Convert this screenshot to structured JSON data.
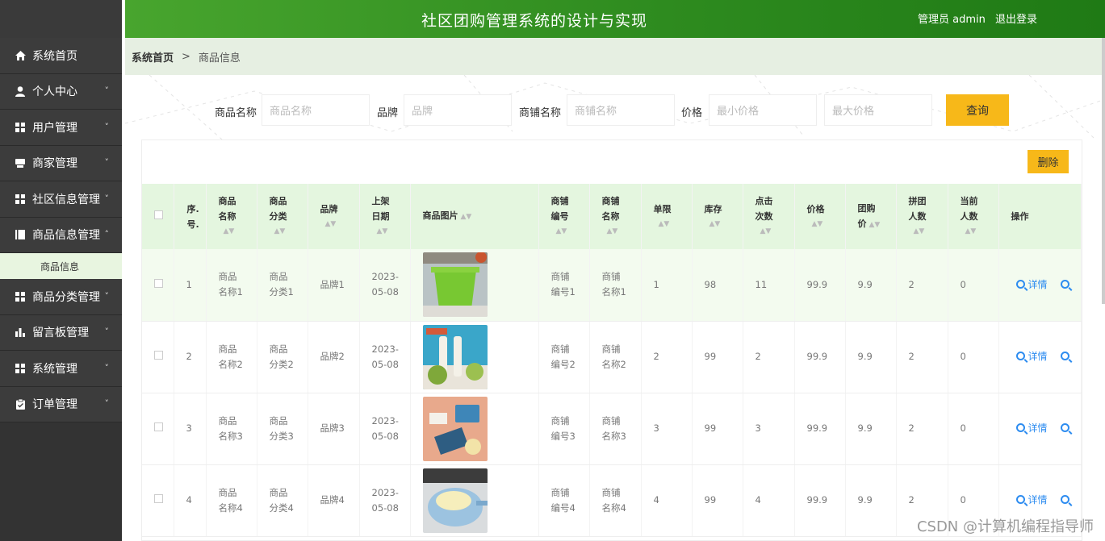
{
  "header": {
    "title": "社区团购管理系统的设计与实现",
    "user_label": "管理员 admin",
    "logout_label": "退出登录"
  },
  "sidebar": {
    "items": [
      {
        "label": "系统首页",
        "icon": "home-icon"
      },
      {
        "label": "个人中心",
        "icon": "user-icon"
      },
      {
        "label": "用户管理",
        "icon": "grid-icon"
      },
      {
        "label": "商家管理",
        "icon": "store-icon"
      },
      {
        "label": "社区信息管理",
        "icon": "grid-icon"
      },
      {
        "label": "商品信息管理",
        "icon": "book-icon"
      },
      {
        "label": "商品分类管理",
        "icon": "grid-icon"
      },
      {
        "label": "留言板管理",
        "icon": "bar-chart-icon"
      },
      {
        "label": "系统管理",
        "icon": "grid-icon"
      },
      {
        "label": "订单管理",
        "icon": "clipboard-icon"
      }
    ],
    "submenu_label": "商品信息"
  },
  "breadcrumb": {
    "home": "系统首页",
    "sep": ">",
    "current": "商品信息"
  },
  "search": {
    "name_label": "商品名称",
    "name_placeholder": "商品名称",
    "brand_label": "品牌",
    "brand_placeholder": "品牌",
    "shop_label": "商铺名称",
    "shop_placeholder": "商铺名称",
    "price_label": "价格",
    "min_placeholder": "最小价格",
    "max_placeholder": "最大价格",
    "query_label": "查询"
  },
  "delete_label": "删除",
  "table": {
    "headers": {
      "index": [
        "序.",
        "号."
      ],
      "name": [
        "商品",
        "名称"
      ],
      "category": [
        "商品",
        "分类"
      ],
      "brand": "品牌",
      "date": [
        "上架",
        "日期"
      ],
      "image": "商品图片",
      "shop_no": [
        "商铺",
        "编号"
      ],
      "shop_name": [
        "商铺",
        "名称"
      ],
      "limit": "单限",
      "stock": "库存",
      "clicks": [
        "点击",
        "次数"
      ],
      "price": "价格",
      "group_price": [
        "团购",
        "价"
      ],
      "group_size": [
        "拼团",
        "人数"
      ],
      "current": [
        "当前",
        "人数"
      ],
      "ops": "操作"
    },
    "rows": [
      {
        "index": "1",
        "name": [
          "商品",
          "名称1"
        ],
        "category": [
          "商品",
          "分类1"
        ],
        "brand": "品牌1",
        "date": [
          "2023-",
          "05-08"
        ],
        "shop_no": [
          "商铺",
          "编号1"
        ],
        "shop_name": [
          "商铺",
          "名称1"
        ],
        "limit": "1",
        "stock": "98",
        "clicks": "11",
        "price": "99.9",
        "group_price": "9.9",
        "group_size": "2",
        "current": "0",
        "detail": "详情",
        "image": "green-bin"
      },
      {
        "index": "2",
        "name": [
          "商品",
          "名称2"
        ],
        "category": [
          "商品",
          "分类2"
        ],
        "brand": "品牌2",
        "date": [
          "2023-",
          "05-08"
        ],
        "shop_no": [
          "商铺",
          "编号2"
        ],
        "shop_name": [
          "商铺",
          "名称2"
        ],
        "limit": "2",
        "stock": "99",
        "clicks": "2",
        "price": "99.9",
        "group_price": "9.9",
        "group_size": "2",
        "current": "0",
        "detail": "详情",
        "image": "film-roll"
      },
      {
        "index": "3",
        "name": [
          "商品",
          "名称3"
        ],
        "category": [
          "商品",
          "分类3"
        ],
        "brand": "品牌3",
        "date": [
          "2023-",
          "05-08"
        ],
        "shop_no": [
          "商铺",
          "编号3"
        ],
        "shop_name": [
          "商铺",
          "名称3"
        ],
        "limit": "3",
        "stock": "99",
        "clicks": "3",
        "price": "99.9",
        "group_price": "9.9",
        "group_size": "2",
        "current": "0",
        "detail": "详情",
        "image": "grater"
      },
      {
        "index": "4",
        "name": [
          "商品",
          "名称4"
        ],
        "category": [
          "商品",
          "分类4"
        ],
        "brand": "品牌4",
        "date": [
          "2023-",
          "05-08"
        ],
        "shop_no": [
          "商铺",
          "编号4"
        ],
        "shop_name": [
          "商铺",
          "名称4"
        ],
        "limit": "4",
        "stock": "99",
        "clicks": "4",
        "price": "99.9",
        "group_price": "9.9",
        "group_size": "2",
        "current": "0",
        "detail": "详情",
        "image": "colander"
      }
    ]
  },
  "watermark": "CSDN @计算机编程指导师",
  "colors": {
    "accent": "#2e8b1f",
    "button": "#f7b819",
    "link": "#2d8cf0",
    "sidebar": "#333333"
  }
}
